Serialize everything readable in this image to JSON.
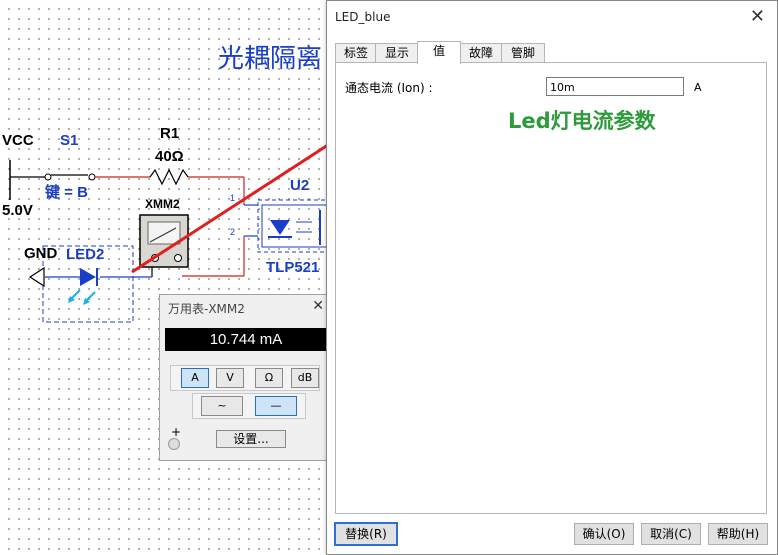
{
  "schematic": {
    "title": "光耦隔离",
    "vcc_label": "VCC",
    "vcc_value": "5.0V",
    "switch_ref": "S1",
    "switch_key": "键 = B",
    "resistor_ref": "R1",
    "resistor_value": "40Ω",
    "meter_ref": "XMM2",
    "ic_ref": "U2",
    "ic_part": "TLP521",
    "gnd_label": "GND",
    "led_ref": "LED2",
    "pin1": "1",
    "pin2": "2"
  },
  "multimeter": {
    "title": "万用表-XMM2",
    "reading": "10.744 mA",
    "mode_buttons": [
      "A",
      "V",
      "Ω",
      "dB"
    ],
    "selected_mode": "A",
    "wave_buttons": [
      "~",
      "—"
    ],
    "selected_wave": "—",
    "settings_label": "设置...",
    "plus_label": "+"
  },
  "dialog": {
    "title": "LED_blue",
    "tabs": [
      "标签",
      "显示",
      "值",
      "故障",
      "管脚"
    ],
    "active_tab": "值",
    "field_label": "通态电流 (Ion) :",
    "field_value": "10m",
    "field_unit": "A",
    "annotation": "Led灯电流参数",
    "buttons": {
      "replace": "替换(R)",
      "ok": "确认(O)",
      "cancel": "取消(C)",
      "help": "帮助(H)"
    }
  },
  "colors": {
    "schematic_blue": "#1a3ec8",
    "wire_red": "#d12020",
    "annotation_green": "#2e9a3c",
    "arrow_red": "#e02020"
  }
}
